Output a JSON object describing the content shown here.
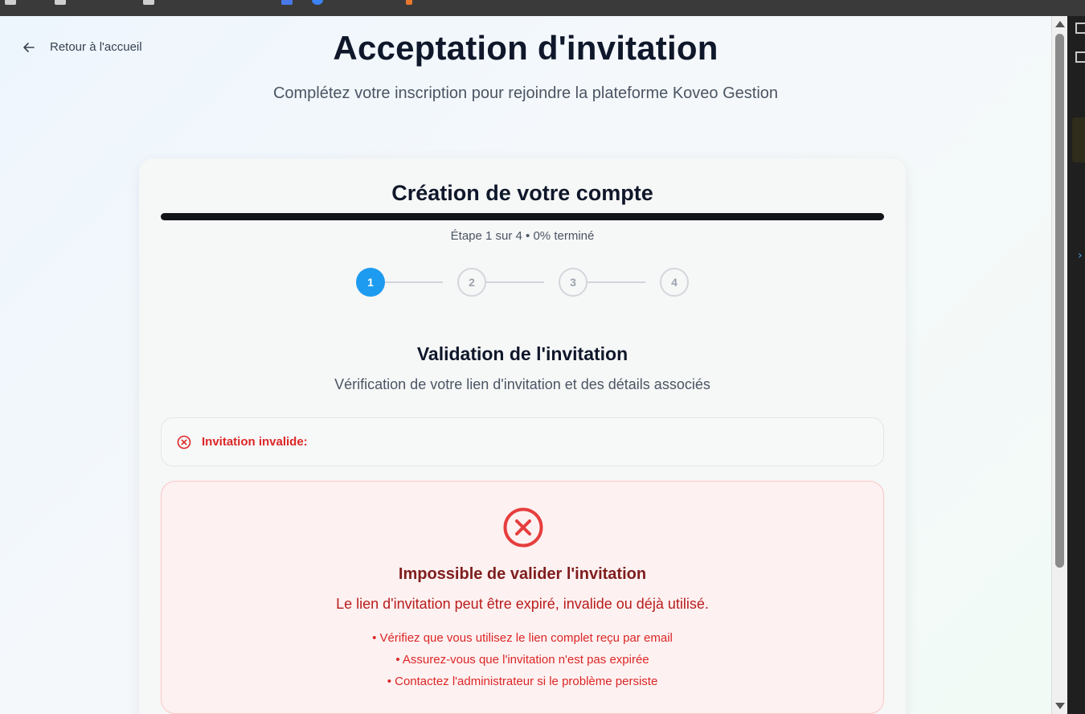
{
  "header": {
    "back_label": "Retour à l'accueil",
    "title": "Acceptation d'invitation",
    "subtitle": "Complétez votre inscription pour rejoindre la plateforme Koveo Gestion"
  },
  "card": {
    "title": "Création de votre compte",
    "progress_percent": 0,
    "step_text": "Étape 1 sur 4 • 0% terminé",
    "steps": [
      {
        "label": "1",
        "state": "active"
      },
      {
        "label": "2",
        "state": "inactive"
      },
      {
        "label": "3",
        "state": "inactive"
      },
      {
        "label": "4",
        "state": "inactive"
      }
    ],
    "section_title": "Validation de l'invitation",
    "section_subtitle": "Vérification de votre lien d'invitation et des détails associés"
  },
  "alert": {
    "icon": "x-circle-icon",
    "label": "Invitation invalide:"
  },
  "error": {
    "icon": "x-circle-icon",
    "title": "Impossible de valider l'invitation",
    "description": "Le lien d'invitation peut être expiré, invalide ou déjà utilisé.",
    "tips": [
      "• Vérifiez que vous utilisez le lien complet reçu par email",
      "• Assurez-vous que l'invitation n'est pas expirée",
      "• Contactez l'administrateur si le problème persiste"
    ]
  },
  "colors": {
    "accent": "#1d9bf0",
    "progress": "#111418",
    "error_text": "#dc2626",
    "error_title": "#7f1d1d",
    "error_bg": "#fef1f1",
    "title": "#0f172a"
  }
}
